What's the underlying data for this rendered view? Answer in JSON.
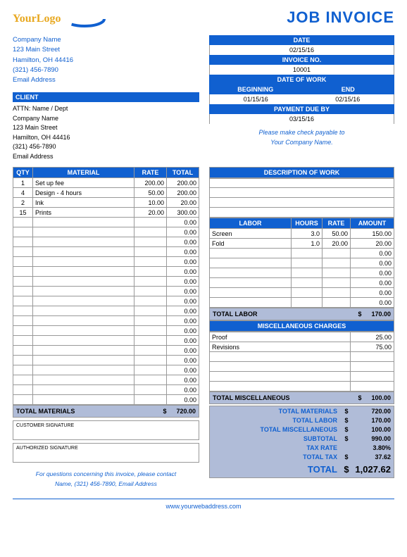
{
  "header": {
    "logo_text": "YourLogo",
    "title": "JOB INVOICE"
  },
  "company": {
    "name": "Company Name",
    "street": "123 Main Street",
    "city": "Hamilton, OH  44416",
    "phone": "(321) 456-7890",
    "email": "Email Address"
  },
  "client_hdr": "CLIENT",
  "client": {
    "attn": "ATTN: Name / Dept",
    "name": "Company Name",
    "street": "123 Main Street",
    "city": "Hamilton, OH  44416",
    "phone": "(321) 456-7890",
    "email": "Email Address"
  },
  "meta": {
    "date_hdr": "DATE",
    "date": "02/15/16",
    "invno_hdr": "INVOICE NO.",
    "invno": "10001",
    "dow_hdr": "DATE OF WORK",
    "begin_hdr": "BEGINNING",
    "end_hdr": "END",
    "begin": "01/15/16",
    "end": "02/15/16",
    "due_hdr": "PAYMENT DUE BY",
    "due": "03/15/16",
    "payable1": "Please make check payable to",
    "payable2": "Your Company Name."
  },
  "mat_hdr": {
    "qty": "QTY",
    "mat": "MATERIAL",
    "rate": "RATE",
    "total": "TOTAL"
  },
  "materials": [
    {
      "qty": "1",
      "name": "Set up fee",
      "rate": "200.00",
      "total": "200.00"
    },
    {
      "qty": "4",
      "name": "Design - 4 hours",
      "rate": "50.00",
      "total": "200.00"
    },
    {
      "qty": "2",
      "name": "Ink",
      "rate": "10.00",
      "total": "20.00"
    },
    {
      "qty": "15",
      "name": "Prints",
      "rate": "20.00",
      "total": "300.00"
    }
  ],
  "mat_empty_rows": 19,
  "mat_total_lbl": "TOTAL MATERIALS",
  "mat_total": "720.00",
  "dow_desc_hdr": "DESCRIPTION OF WORK",
  "desc_empty_rows": 4,
  "lab_hdr": {
    "labor": "LABOR",
    "hours": "HOURS",
    "rate": "RATE",
    "amount": "AMOUNT"
  },
  "labor": [
    {
      "name": "Screen",
      "hours": "3.0",
      "rate": "50.00",
      "amount": "150.00"
    },
    {
      "name": "Fold",
      "hours": "1.0",
      "rate": "20.00",
      "amount": "20.00"
    }
  ],
  "lab_empty_rows": 6,
  "lab_total_lbl": "TOTAL LABOR",
  "lab_total": "170.00",
  "misc_hdr": "MISCELLANEOUS CHARGES",
  "misc": [
    {
      "name": "Proof",
      "amount": "25.00"
    },
    {
      "name": "Revisions",
      "amount": "75.00"
    }
  ],
  "misc_empty_rows": 4,
  "misc_total_lbl": "TOTAL MISCELLANEOUS",
  "misc_total": "100.00",
  "sig": {
    "customer": "CUSTOMER SIGNATURE",
    "authorized": "AUTHORIZED SIGNATURE"
  },
  "contact": {
    "line1": "For questions concerning this invoice, please contact",
    "line2": "Name, (321) 456-7890, Email Address"
  },
  "summary": {
    "mat_lbl": "TOTAL MATERIALS",
    "mat": "720.00",
    "lab_lbl": "TOTAL LABOR",
    "lab": "170.00",
    "misc_lbl": "TOTAL MISCELLANEOUS",
    "misc": "100.00",
    "sub_lbl": "SUBTOTAL",
    "sub": "990.00",
    "rate_lbl": "TAX RATE",
    "rate": "3.80%",
    "tax_lbl": "TOTAL TAX",
    "tax": "37.62",
    "tot_lbl": "TOTAL",
    "tot": "1,027.62"
  },
  "currency": "$",
  "zero": "0.00",
  "footer": "www.yourwebaddress.com"
}
